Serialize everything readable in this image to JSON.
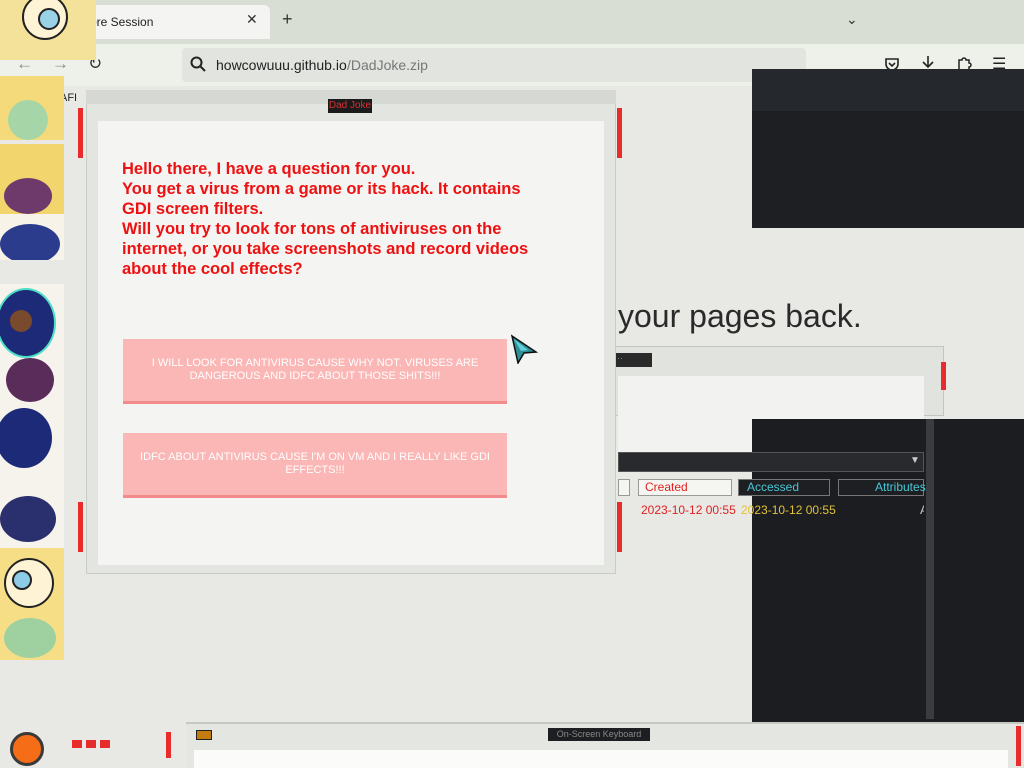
{
  "browser": {
    "tab_title": "Restore Session",
    "tab_title_visible": "ore Session",
    "url_host": "howcowuuu.github.io",
    "url_path": "/DadJoke.zip",
    "partial_label": "AFI"
  },
  "background_page": {
    "headline_fragment": "your pages back."
  },
  "explorer": {
    "columns": [
      "Created",
      "Accessed",
      "Attributes"
    ],
    "row": {
      "created": "2023-10-12 00:55",
      "accessed": "2023-10-12 00:55",
      "attributes": "A"
    }
  },
  "dialog": {
    "title": "Dad Joke",
    "message_lines": [
      "Hello there, I have a question for you.",
      "You get a virus from a game or its hack. It contains",
      "GDI screen filters.",
      "Will you try to look for tons of antiviruses on the",
      "internet, or you take screenshots and record videos",
      "about the cool effects?"
    ],
    "option_1": "I WILL LOOK FOR ANTIVIRUS CAUSE WHY NOT. VIRUSES ARE DANGEROUS AND IDFC ABOUT THOSE SHITS!!!",
    "option_2": "IDFC ABOUT ANTIVIRUS CAUSE I'M ON VM AND I REALLY LIKE GDI EFFECTS!!!"
  },
  "keyboard_window": {
    "title": "On-Screen Keyboard"
  },
  "colors": {
    "message_red": "#ee1111",
    "button_pink": "#fbb6b6",
    "accent_cyan": "#46c7d6"
  }
}
